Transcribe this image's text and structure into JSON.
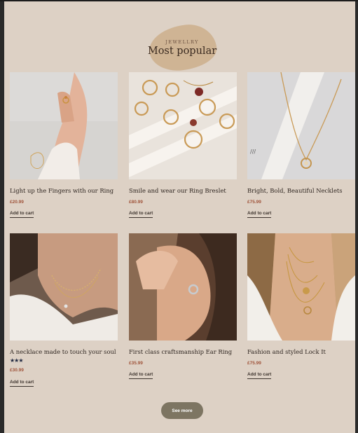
{
  "section": {
    "eyebrow": "JEWELLRY",
    "title": "Most popular"
  },
  "products": [
    {
      "name": "Light up the Fingers with our Ring",
      "price": "£20.99",
      "cta": "Add to cart",
      "image": "ring-on-hand-photo"
    },
    {
      "name": "Smile and wear our Ring Breslet",
      "price": "£80.99",
      "cta": "Add to cart",
      "image": "gold-rings-photo"
    },
    {
      "name": "Bright, Bold, Beautiful Necklets",
      "price": "£75.99",
      "cta": "Add to cart",
      "image": "pendant-necklace-photo"
    },
    {
      "name": "A necklace made to touch your soul",
      "rating": 3,
      "stars_text": "★★★",
      "price": "£30.99",
      "cta": "Add to cart",
      "image": "woman-necklace-photo"
    },
    {
      "name": "First class craftsmanship Ear Ring",
      "price": "£35.99",
      "cta": "Add to cart",
      "image": "ear-ring-photo"
    },
    {
      "name": "Fashion and styled Lock It",
      "price": "£75.99",
      "cta": "Add to cart",
      "image": "layered-necklaces-photo"
    }
  ],
  "see_more_label": "See more",
  "colors": {
    "background": "#ddd1c5",
    "blob": "#cfb494",
    "price": "#a0553c",
    "button": "#7d7562",
    "stars": "#1f2740"
  }
}
